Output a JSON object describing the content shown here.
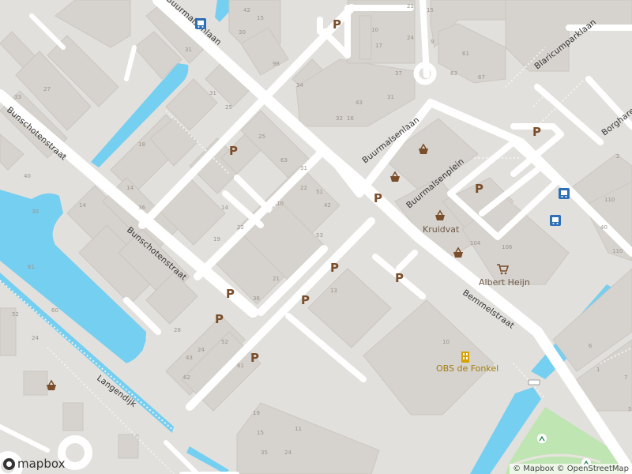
{
  "map": {
    "colors": {
      "background": "#e2e0dd",
      "building": "#d6d2cd",
      "building_outline": "#cbc6c0",
      "water": "#75cff0",
      "park": "#bfe5b3",
      "road": "#ffffff",
      "footpath": "#ffffff",
      "parking_symbol": "#7a4e2a",
      "shop_symbol": "#7a4e2a",
      "bus_stop": "#2f6fb8",
      "school": "#a07d10"
    },
    "streets": [
      {
        "id": "bunschotenstraat-1",
        "name": "Bunschotenstraat"
      },
      {
        "id": "bunschotenstraat-2",
        "name": "Bunschotenstraat"
      },
      {
        "id": "buurmalsenlaan-1",
        "name": "Buurmalsenlaan"
      },
      {
        "id": "buurmalsenlaan-2",
        "name": "Buurmalsenlaan"
      },
      {
        "id": "buurmalsenplein",
        "name": "Buurmalsenplein"
      },
      {
        "id": "blaricumparklaan",
        "name": "Blaricumparklaan"
      },
      {
        "id": "borghare",
        "name": "Borghare"
      },
      {
        "id": "bemmelstraat",
        "name": "Bemmelstraat"
      },
      {
        "id": "langendijk",
        "name": "Langendijk"
      }
    ],
    "pois": [
      {
        "id": "kruidvat",
        "name": "Kruidvat",
        "icon": "shopping-basket-icon"
      },
      {
        "id": "albert-heijn",
        "name": "Albert Heijn",
        "icon": "shopping-cart-icon"
      },
      {
        "id": "obs-de-fonkel",
        "name": "OBS de Fonkel",
        "icon": "school-icon"
      }
    ],
    "parking_label": "P",
    "house_numbers": [
      "30",
      "15",
      "98",
      "42",
      "31",
      "25",
      "31",
      "33",
      "27",
      "30",
      "34",
      "32",
      "16",
      "43",
      "31",
      "37",
      "17",
      "10",
      "21",
      "24",
      "15",
      "9",
      "63",
      "67",
      "59",
      "61",
      "25",
      "63",
      "22",
      "42",
      "51",
      "31",
      "10",
      "14",
      "22",
      "19",
      "21",
      "36",
      "28",
      "24",
      "43",
      "62",
      "52",
      "61",
      "19",
      "35",
      "24",
      "15",
      "11",
      "13",
      "53",
      "10",
      "104",
      "106",
      "110",
      "110",
      "40",
      "2",
      "7",
      "6",
      "1",
      "5",
      "14",
      "14",
      "36",
      "40",
      "30",
      "61",
      "60",
      "52",
      "24",
      "18"
    ]
  },
  "logo": {
    "text": "mapbox",
    "icon": "mapbox-logo-icon"
  },
  "attribution": {
    "mapbox": "© Mapbox",
    "osm": "© OpenStreetMap"
  }
}
